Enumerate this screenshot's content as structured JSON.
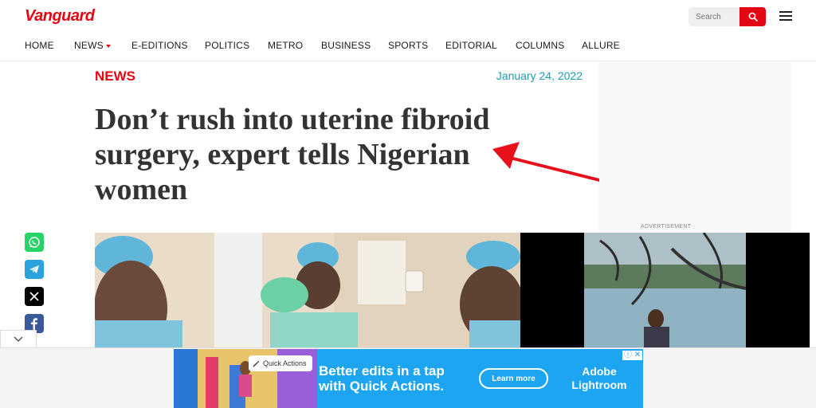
{
  "brand": {
    "logo": "Vanguard"
  },
  "search": {
    "placeholder": "Search"
  },
  "nav": {
    "items": [
      {
        "label": "HOME"
      },
      {
        "label": "NEWS"
      },
      {
        "label": "E-EDITIONS"
      },
      {
        "label": "POLITICS"
      },
      {
        "label": "METRO"
      },
      {
        "label": "BUSINESS"
      },
      {
        "label": "SPORTS"
      },
      {
        "label": "EDITORIAL"
      },
      {
        "label": "COLUMNS"
      },
      {
        "label": "ALLURE"
      }
    ]
  },
  "article": {
    "category": "NEWS",
    "date": "January 24, 2022",
    "headline": "Don’t rush into uterine fibroid surgery, expert tells Nigerian women"
  },
  "sidebar_ad": {
    "label": "ADVERTISEMENT"
  },
  "share": {
    "icons": [
      "whatsapp-icon",
      "telegram-icon",
      "x-icon",
      "facebook-icon"
    ]
  },
  "banner_ad": {
    "chip": "Quick Actions",
    "headline_line1": "Better edits in a tap",
    "headline_line2": "with Quick Actions.",
    "cta": "Learn more",
    "brand_line1": "Adobe",
    "brand_line2": "Lightroom",
    "close": "ⓘ ✕"
  },
  "colors": {
    "accent": "#e30613",
    "date": "#1aa0b5",
    "banner": "#1da5f2"
  }
}
